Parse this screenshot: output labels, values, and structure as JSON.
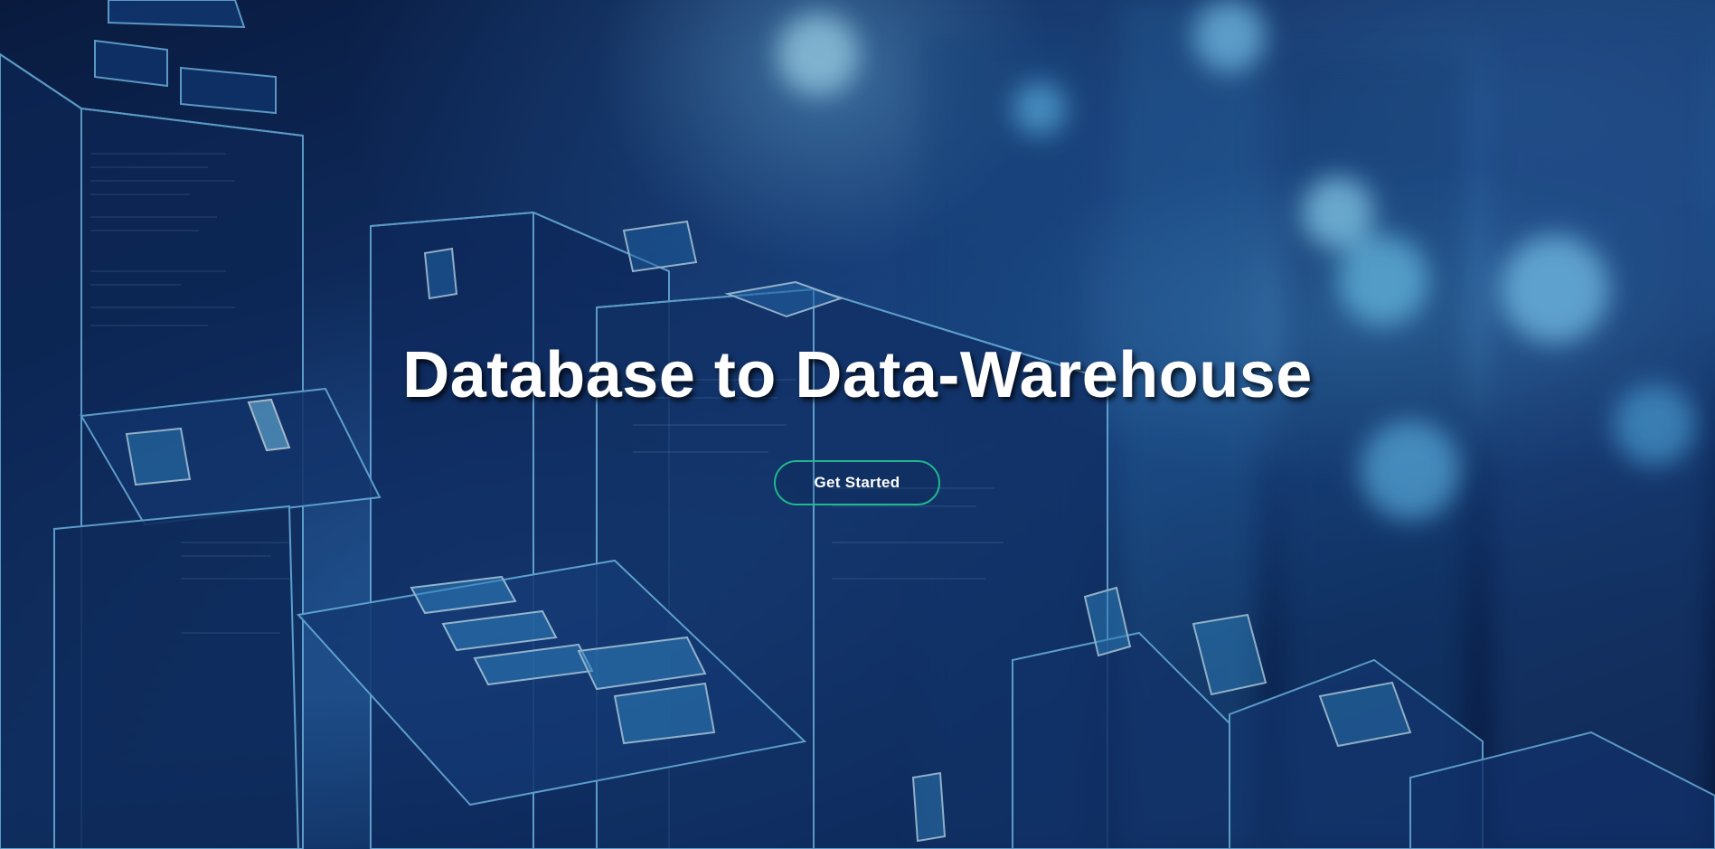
{
  "hero": {
    "title": "Database to Data-Warehouse",
    "cta_label": "Get Started",
    "background_image": "digital-city-data-blocks",
    "accent_color": "#1fb88f",
    "title_color": "#ffffff"
  }
}
